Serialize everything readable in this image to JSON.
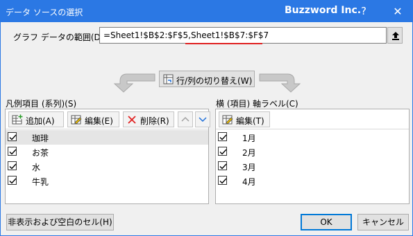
{
  "window": {
    "title": "データ ソースの選択",
    "app": "Buzzword Inc.",
    "help": "?",
    "close": "✕"
  },
  "range": {
    "label": "グラフ データの範囲(D):",
    "value": "=Sheet1!$B$2:$F$5,Sheet1!$B$7:$F$7"
  },
  "switch_button": {
    "label": "行/列の切り替え(W)"
  },
  "legend": {
    "label": "凡例項目 (系列)(S)",
    "add_label": "追加(A)",
    "edit_label": "編集(E)",
    "delete_label": "削除(R)",
    "items": [
      {
        "label": "珈琲",
        "checked": true,
        "selected": true
      },
      {
        "label": "お茶",
        "checked": true,
        "selected": false
      },
      {
        "label": "水",
        "checked": true,
        "selected": false
      },
      {
        "label": "牛乳",
        "checked": true,
        "selected": false
      }
    ]
  },
  "axis": {
    "label": "横 (項目) 軸ラベル(C)",
    "edit_label": "編集(T)",
    "items": [
      {
        "label": "1月",
        "checked": true
      },
      {
        "label": "2月",
        "checked": true
      },
      {
        "label": "3月",
        "checked": true
      },
      {
        "label": "4月",
        "checked": true
      }
    ]
  },
  "footer": {
    "hidden_cells_label": "非表示および空白のセル(H)",
    "ok_label": "OK",
    "cancel_label": "キャンセル"
  },
  "colors": {
    "titlebar": "#2b78e4",
    "delete_icon": "#e02020",
    "highlight_underline": "#e02020"
  }
}
